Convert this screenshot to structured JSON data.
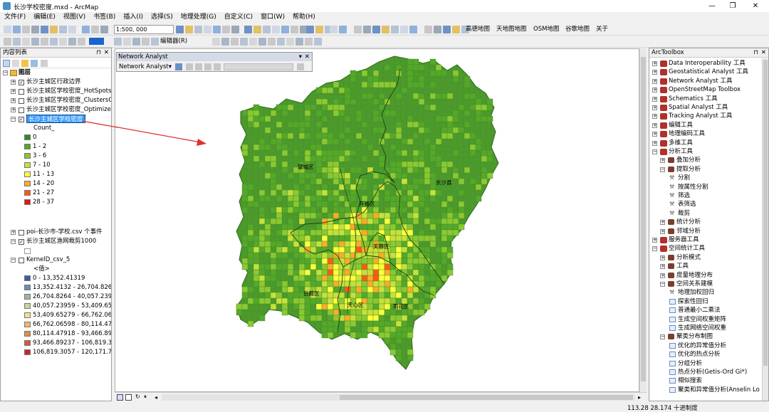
{
  "window": {
    "title": "长沙学校密度.mxd - ArcMap",
    "controls": [
      "—",
      "❐",
      "✕"
    ]
  },
  "menu": [
    "文件(F)",
    "编辑(E)",
    "视图(V)",
    "书签(B)",
    "插入(I)",
    "选择(S)",
    "地理处理(G)",
    "自定义(C)",
    "窗口(W)",
    "帮助(H)"
  ],
  "toolbar": {
    "scale": "1:500, 000",
    "basemaps": [
      "高德地图",
      "天地图地图",
      "OSM地图",
      "谷歌地图",
      "关于"
    ],
    "editor": "编辑器(R)"
  },
  "toc": {
    "title": "内容列表",
    "root": "图层",
    "layers": [
      "长沙主城区行政边界",
      "长沙主城区学校密度_HotSpots",
      "长沙主城区学校密度_ClustersO",
      "长沙主城区学校密度_Optimized",
      "长沙主城区学校密度"
    ],
    "count_field": "Count_",
    "count_classes": [
      {
        "label": "0",
        "color": "#2e8b22"
      },
      {
        "label": "1 - 2",
        "color": "#55a82a"
      },
      {
        "label": "3 - 6",
        "color": "#8cc832"
      },
      {
        "label": "7 - 10",
        "color": "#c8e03c"
      },
      {
        "label": "11 - 13",
        "color": "#ffff3c"
      },
      {
        "label": "14 - 20",
        "color": "#ffaa28"
      },
      {
        "label": "21 - 27",
        "color": "#ff5a14"
      },
      {
        "label": "28 - 37",
        "color": "#e61414"
      }
    ],
    "poi_layer": "poi-长沙市-学校.csv 个事件",
    "fishnet_layer": "长沙主城区渔网裁剪1000",
    "kernel_layer": "KernelD_csv_5",
    "kernel_value": "<值>",
    "kernel_classes": [
      {
        "label": "0 - 13,352.41319",
        "color": "#3a5fa0"
      },
      {
        "label": "13,352.4132 - 26,704.82639",
        "color": "#6b8fb3"
      },
      {
        "label": "26,704.8264 - 40,057.23958",
        "color": "#9cb5a6"
      },
      {
        "label": "40,057.23959 - 53,409.6527",
        "color": "#c8d59a"
      },
      {
        "label": "53,409.65279 - 66,762.0659",
        "color": "#f0e48a"
      },
      {
        "label": "66,762.06598 - 80,114.4791",
        "color": "#f3b66d"
      },
      {
        "label": "80,114.47918 - 93,466.8923",
        "color": "#e8874f"
      },
      {
        "label": "93,466.89237 - 106,819.305",
        "color": "#d9573a"
      },
      {
        "label": "106,819.3057 - 120,171.718",
        "color": "#c4262a"
      }
    ]
  },
  "network_analyst": {
    "title": "Network Analyst",
    "menu": "Network Analyst"
  },
  "map_labels": [
    "望城区",
    "长沙县",
    "开福区",
    "芙蓉区",
    "岳麓区",
    "天心区",
    "雨花区"
  ],
  "toolbox": {
    "title": "ArcToolbox",
    "items": [
      {
        "label": "Data Interoperability 工具",
        "indent": 0,
        "exp": "+",
        "icon": "tb"
      },
      {
        "label": "Geostatistical Analyst 工具",
        "indent": 0,
        "exp": "+",
        "icon": "tb"
      },
      {
        "label": "Network Analyst 工具",
        "indent": 0,
        "exp": "+",
        "icon": "tb"
      },
      {
        "label": "OpenStreetMap Toolbox",
        "indent": 0,
        "exp": "+",
        "icon": "tb"
      },
      {
        "label": "Schematics 工具",
        "indent": 0,
        "exp": "+",
        "icon": "tb"
      },
      {
        "label": "Spatial Analyst 工具",
        "indent": 0,
        "exp": "+",
        "icon": "tb"
      },
      {
        "label": "Tracking Analyst 工具",
        "indent": 0,
        "exp": "+",
        "icon": "tb"
      },
      {
        "label": "编辑工具",
        "indent": 0,
        "exp": "+",
        "icon": "tb"
      },
      {
        "label": "地理编码工具",
        "indent": 0,
        "exp": "+",
        "icon": "tb"
      },
      {
        "label": "多维工具",
        "indent": 0,
        "exp": "+",
        "icon": "tb"
      },
      {
        "label": "分析工具",
        "indent": 0,
        "exp": "-",
        "icon": "tb"
      },
      {
        "label": "叠加分析",
        "indent": 1,
        "exp": "+",
        "icon": "ts"
      },
      {
        "label": "提取分析",
        "indent": 1,
        "exp": "-",
        "icon": "ts"
      },
      {
        "label": "分割",
        "indent": 2,
        "exp": "",
        "icon": "tool"
      },
      {
        "label": "按属性分割",
        "indent": 2,
        "exp": "",
        "icon": "tool"
      },
      {
        "label": "筛选",
        "indent": 2,
        "exp": "",
        "icon": "tool"
      },
      {
        "label": "表筛选",
        "indent": 2,
        "exp": "",
        "icon": "tool"
      },
      {
        "label": "裁剪",
        "indent": 2,
        "exp": "",
        "icon": "tool"
      },
      {
        "label": "统计分析",
        "indent": 1,
        "exp": "+",
        "icon": "ts"
      },
      {
        "label": "邻域分析",
        "indent": 1,
        "exp": "+",
        "icon": "ts"
      },
      {
        "label": "服务器工具",
        "indent": 0,
        "exp": "+",
        "icon": "tb"
      },
      {
        "label": "空间统计工具",
        "indent": 0,
        "exp": "-",
        "icon": "tb"
      },
      {
        "label": "分析模式",
        "indent": 1,
        "exp": "+",
        "icon": "ts"
      },
      {
        "label": "工具",
        "indent": 1,
        "exp": "+",
        "icon": "ts"
      },
      {
        "label": "度量地理分布",
        "indent": 1,
        "exp": "+",
        "icon": "ts"
      },
      {
        "label": "空间关系建模",
        "indent": 1,
        "exp": "-",
        "icon": "ts"
      },
      {
        "label": "地理加权回归",
        "indent": 2,
        "exp": "",
        "icon": "tool"
      },
      {
        "label": "探索性回归",
        "indent": 2,
        "exp": "",
        "icon": "script"
      },
      {
        "label": "普通最小二乘法",
        "indent": 2,
        "exp": "",
        "icon": "script"
      },
      {
        "label": "生成空间权重矩阵",
        "indent": 2,
        "exp": "",
        "icon": "script"
      },
      {
        "label": "生成网络空间权重",
        "indent": 2,
        "exp": "",
        "icon": "script"
      },
      {
        "label": "聚类分布制图",
        "indent": 1,
        "exp": "-",
        "icon": "ts"
      },
      {
        "label": "优化的异常值分析",
        "indent": 2,
        "exp": "",
        "icon": "script"
      },
      {
        "label": "优化的热点分析",
        "indent": 2,
        "exp": "",
        "icon": "script"
      },
      {
        "label": "分组分析",
        "indent": 2,
        "exp": "",
        "icon": "script"
      },
      {
        "label": "热点分析(Getis-Ord Gi*)",
        "indent": 2,
        "exp": "",
        "icon": "script"
      },
      {
        "label": "相似搜索",
        "indent": 2,
        "exp": "",
        "icon": "script"
      },
      {
        "label": "聚类和异常值分析(Anselin Lo",
        "indent": 2,
        "exp": "",
        "icon": "script"
      }
    ]
  },
  "status": {
    "coords": "113.28  28.174 十进制度"
  }
}
